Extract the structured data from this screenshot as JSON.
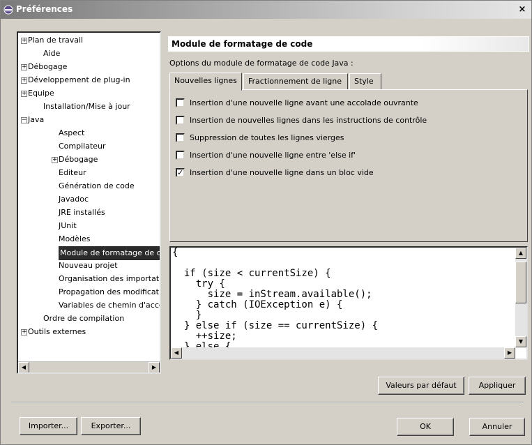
{
  "window": {
    "title": "Préférences",
    "close_glyph": "×"
  },
  "tree": {
    "items": [
      {
        "label": "Plan de travail",
        "expander": "+"
      },
      {
        "label": "Aide",
        "expander": ""
      },
      {
        "label": "Débogage",
        "expander": "+"
      },
      {
        "label": "Développement de plug-in",
        "expander": "+"
      },
      {
        "label": "Equipe",
        "expander": "+"
      },
      {
        "label": "Installation/Mise à jour",
        "expander": ""
      },
      {
        "label": "Java",
        "expander": "−"
      },
      {
        "label": "Aspect",
        "expander": ""
      },
      {
        "label": "Compilateur",
        "expander": ""
      },
      {
        "label": "Débogage",
        "expander": "+"
      },
      {
        "label": "Editeur",
        "expander": ""
      },
      {
        "label": "Génération de code",
        "expander": ""
      },
      {
        "label": "Javadoc",
        "expander": ""
      },
      {
        "label": "JRE installés",
        "expander": ""
      },
      {
        "label": "JUnit",
        "expander": ""
      },
      {
        "label": "Modèles",
        "expander": ""
      },
      {
        "label": "Module de formatage de c",
        "expander": "",
        "selected": true
      },
      {
        "label": "Nouveau projet",
        "expander": ""
      },
      {
        "label": "Organisation des importati",
        "expander": ""
      },
      {
        "label": "Propagation des modificati",
        "expander": ""
      },
      {
        "label": "Variables de chemin d'accè",
        "expander": ""
      },
      {
        "label": "Ordre de compilation",
        "expander": ""
      },
      {
        "label": "Outils externes",
        "expander": "+"
      }
    ]
  },
  "panel": {
    "title": "Module de formatage de code",
    "options_label": "Options du module de formatage de code Java :",
    "tabs": [
      {
        "label": "Nouvelles lignes",
        "active": true
      },
      {
        "label": "Fractionnement de ligne",
        "active": false
      },
      {
        "label": "Style",
        "active": false
      }
    ],
    "checkboxes": [
      {
        "label": "Insertion d'une nouvelle ligne avant une accolade ouvrante",
        "checked": false
      },
      {
        "label": "Insertion de nouvelles lignes  dans les instructions de contrôle",
        "checked": false
      },
      {
        "label": "Suppression de toutes les lignes vierges",
        "checked": false
      },
      {
        "label": "Insertion d'une nouvelle ligne entre  'else if'",
        "checked": false
      },
      {
        "label": "Insertion d'une nouvelle ligne dans un bloc vide",
        "checked": true
      }
    ],
    "check_glyph": "✓",
    "preview_code": "{\n\n  if (size < currentSize) {\n    try {\n      size = inStream.available();\n    } catch (IOException e) {\n    }\n  } else if (size == currentSize) {\n    ++size;\n  } else {"
  },
  "buttons": {
    "defaults": "Valeurs par défaut",
    "apply": "Appliquer",
    "import": "Importer...",
    "export": "Exporter...",
    "ok": "OK",
    "cancel": "Annuler"
  }
}
